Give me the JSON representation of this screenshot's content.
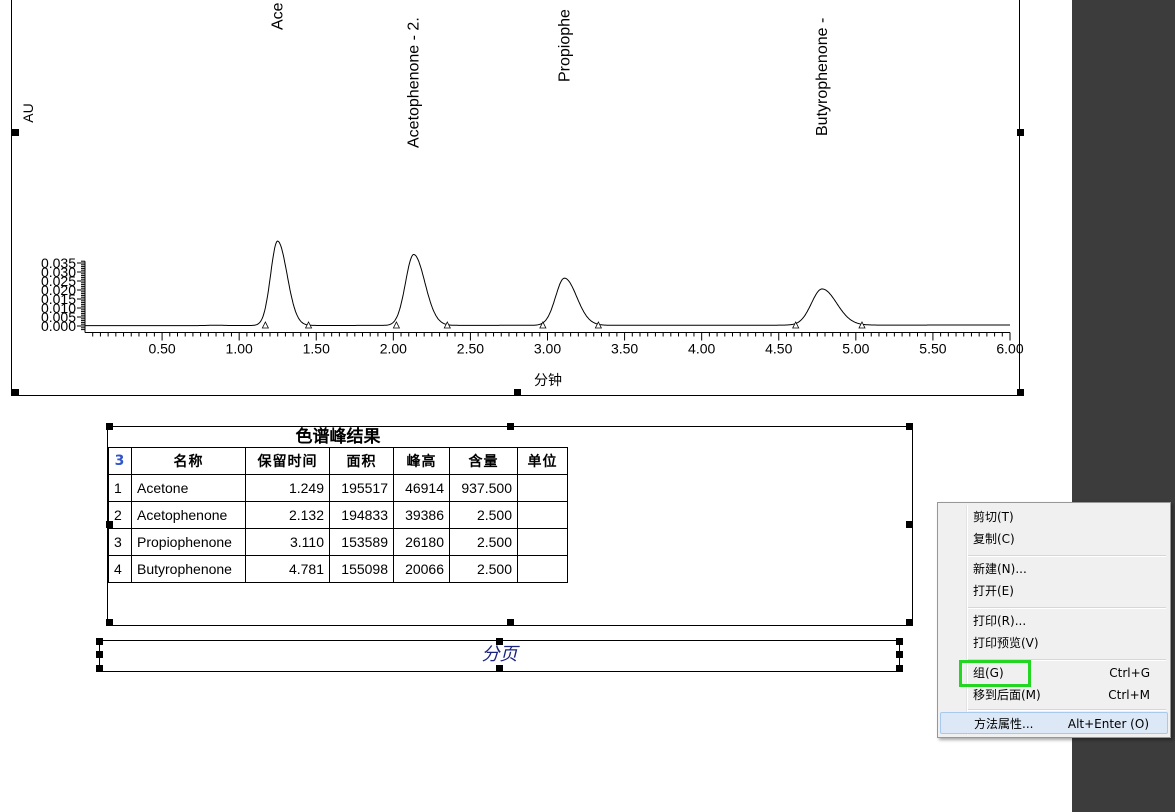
{
  "chart_data": {
    "type": "line",
    "xlabel": "分钟",
    "ylabel": "AU",
    "xlim": [
      0.0,
      6.0
    ],
    "ylim": [
      -0.0025,
      0.036
    ],
    "xticks": [
      "0.50",
      "1.00",
      "1.50",
      "2.00",
      "2.50",
      "3.00",
      "3.50",
      "4.00",
      "4.50",
      "5.00",
      "5.50",
      "6.00"
    ],
    "yticks": [
      "0.000",
      "0.005",
      "0.010",
      "0.015",
      "0.020",
      "0.025",
      "0.030",
      "0.035"
    ],
    "peaks": [
      {
        "label": "Ace",
        "rt": 1.249,
        "height": 0.0469,
        "start": 1.17,
        "end": 1.45
      },
      {
        "label": "Acetophenone - 2.",
        "rt": 2.132,
        "height": 0.0394,
        "start": 2.02,
        "end": 2.35
      },
      {
        "label": "Propiophe",
        "rt": 3.11,
        "height": 0.0262,
        "start": 2.97,
        "end": 3.33
      },
      {
        "label": "Butyrophenone -",
        "rt": 4.781,
        "height": 0.0201,
        "start": 4.61,
        "end": 5.04
      }
    ]
  },
  "results": {
    "title": "色谱峰结果",
    "corner_mark": "3",
    "headers": [
      "名称",
      "保留时间",
      "面积",
      "峰高",
      "含量",
      "单位"
    ],
    "rows": [
      {
        "index": "1",
        "name": "Acetone",
        "rt": "1.249",
        "area": "195517",
        "height": "46914",
        "amount": "937.500",
        "unit": ""
      },
      {
        "index": "2",
        "name": "Acetophenone",
        "rt": "2.132",
        "area": "194833",
        "height": "39386",
        "amount": "2.500",
        "unit": ""
      },
      {
        "index": "3",
        "name": "Propiophenone",
        "rt": "3.110",
        "area": "153589",
        "height": "26180",
        "amount": "2.500",
        "unit": ""
      },
      {
        "index": "4",
        "name": "Butyrophenone",
        "rt": "4.781",
        "area": "155098",
        "height": "20066",
        "amount": "2.500",
        "unit": ""
      }
    ]
  },
  "page_break": {
    "label": "分页"
  },
  "context_menu": {
    "items": [
      {
        "label": "剪切(T)",
        "shortcut": ""
      },
      {
        "label": "复制(C)",
        "shortcut": ""
      },
      {
        "label": "新建(N)...",
        "shortcut": ""
      },
      {
        "label": "打开(E)",
        "shortcut": ""
      },
      {
        "label": "打印(R)...",
        "shortcut": ""
      },
      {
        "label": "打印预览(V)",
        "shortcut": ""
      },
      {
        "label": "组(G)",
        "shortcut": "Ctrl+G"
      },
      {
        "label": "移到后面(M)",
        "shortcut": "Ctrl+M"
      },
      {
        "label": "方法属性...",
        "shortcut": "Alt+Enter (O)"
      }
    ],
    "highlight_color": "#22d622"
  }
}
